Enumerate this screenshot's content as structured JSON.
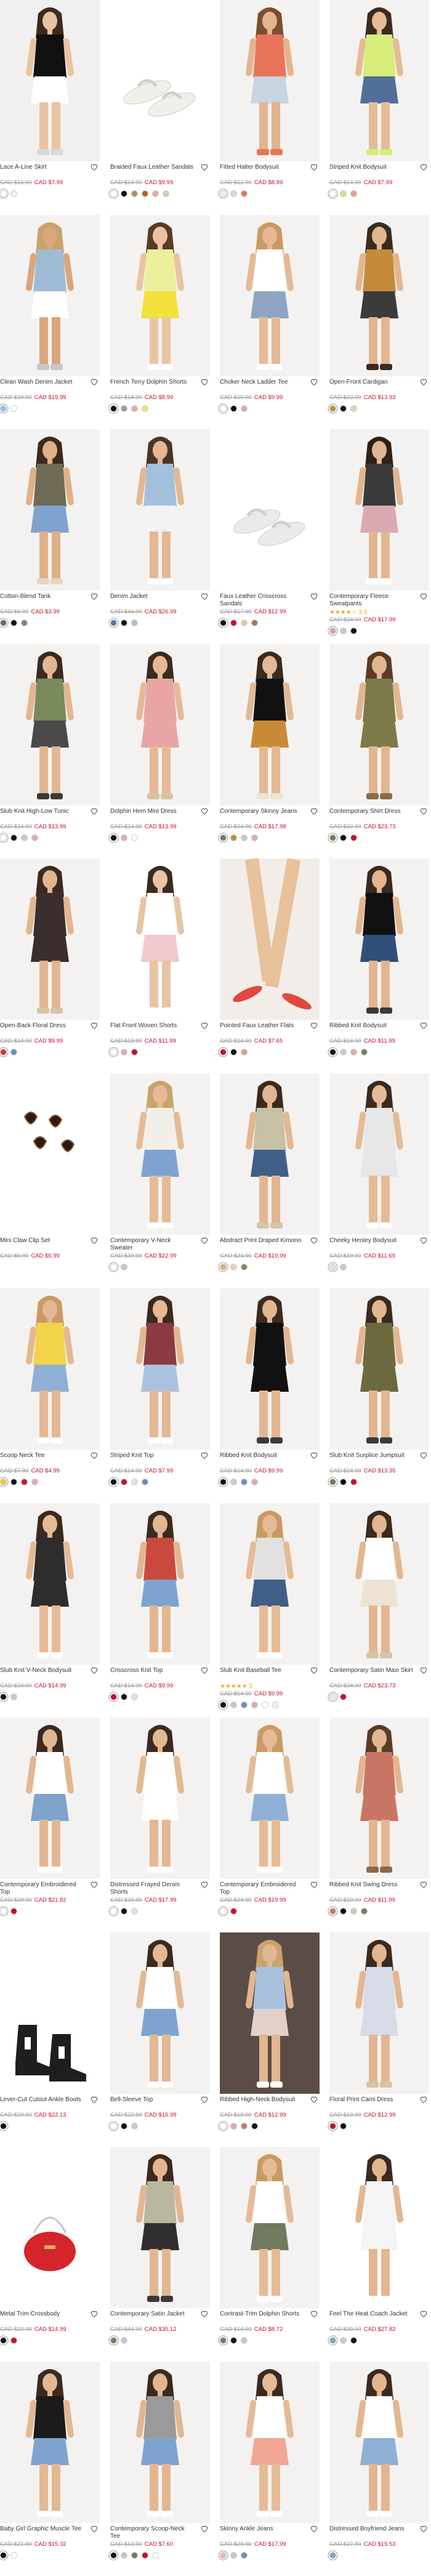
{
  "products": [
    {
      "name": "Lace A-Line Skirt",
      "old_price": "CAD $16.90",
      "price": "CAD $7.99",
      "price_type": "sale",
      "swatches": [
        "#ffffff",
        "#f2f2f2"
      ],
      "photo": {
        "bg": "#f2f0ee",
        "skin": "#e8c4a2",
        "hair": "#3b2a1f",
        "top": "#111111",
        "bottom": "#ffffff",
        "shoe": "#d9d9d9"
      }
    },
    {
      "name": "Braided Faux Leather Sandals",
      "old_price": "CAD $14.90",
      "price": "CAD $9.99",
      "price_type": "sale",
      "swatches": [
        "#ffffff",
        "#111111",
        "#b98a5e",
        "#b5651d",
        "#e3a6a8",
        "#d8c9b3"
      ],
      "photo": {
        "bg": "#ffffff",
        "item": "sandals",
        "sole": "#f1efe9",
        "strap": "#f7f7f7"
      }
    },
    {
      "name": "Fitted Halter Bodysuit",
      "old_price": "CAD $12.90",
      "price": "CAD $8.99",
      "price_type": "sale",
      "swatches": [
        "#f0f0f0",
        "#d9d9d9",
        "#e8745a"
      ],
      "photo": {
        "bg": "#f4f2f0",
        "skin": "#e2b48f",
        "hair": "#7a4e2e",
        "top": "#e8745a",
        "bottom": "#c8d4e0",
        "shoe": "#e8745a"
      }
    },
    {
      "name": "Striped Knit Bodysuit",
      "old_price": "CAD $14.90",
      "price": "CAD $7.99",
      "price_type": "sale",
      "swatches": [
        "#ffffff",
        "#cfe37a",
        "#e0a089"
      ],
      "photo": {
        "bg": "#f4f2f0",
        "skin": "#e4bb95",
        "hair": "#3a2a20",
        "top": "#d7ec79",
        "bottom": "#4f6f99",
        "shoe": "#d7ec79"
      }
    },
    {
      "name": "Clean Wash Denim Jacket",
      "old_price": "CAD $39.90",
      "price": "CAD $19.99",
      "price_type": "sale",
      "swatches": [
        "#9fbbd6",
        "#ffffff"
      ],
      "photo": {
        "bg": "#f4f2f0",
        "skin": "#d9a67e",
        "hair": "#c9a36b",
        "top": "#9fbbd6",
        "bottom": "#ffffff",
        "shoe": "#c7c7c7"
      }
    },
    {
      "name": "French Terry Dolphin Shorts",
      "old_price": "CAD $14.90",
      "price": "CAD $8.99",
      "price_type": "sale",
      "swatches": [
        "#111111",
        "#9a9a9a",
        "#e0a9b0",
        "#f2e46b"
      ],
      "photo": {
        "bg": "#f4f2f0",
        "skin": "#e8c4a2",
        "hair": "#5a3b24",
        "top": "#ecf09a",
        "bottom": "#f2e13b",
        "shoe": "#ffffff"
      }
    },
    {
      "name": "Choker Neck Ladder Tee",
      "old_price": "CAD $19.90",
      "price": "CAD $9.99",
      "price_type": "sale",
      "swatches": [
        "#ffffff",
        "#111111",
        "#e0a9b0"
      ],
      "photo": {
        "bg": "#f4f2f0",
        "skin": "#e5b996",
        "hair": "#c99a63",
        "top": "#ffffff",
        "bottom": "#8ea4c2",
        "shoe": "#ffffff"
      }
    },
    {
      "name": "Open-Front Cardigan",
      "old_price": "CAD $22.90",
      "price": "CAD $13.93",
      "price_type": "sale",
      "swatches": [
        "#c58a3a",
        "#111111",
        "#e0d2b8"
      ],
      "photo": {
        "bg": "#f4f2f0",
        "skin": "#e2b690",
        "hair": "#3b2a1f",
        "top": "#c58a3a",
        "bottom": "#3b3b3b",
        "shoe": "#3a2a20"
      }
    },
    {
      "name": "Cotton-Blend Tank",
      "old_price": "CAD $6.90",
      "price": "CAD $3.99",
      "price_type": "sale",
      "swatches": [
        "#6b6b6b",
        "#111111",
        "#8f7f6a"
      ],
      "photo": {
        "bg": "#f4f2f0",
        "skin": "#e0b088",
        "hair": "#3a2a20",
        "top": "#6f6a55",
        "bottom": "#7fa3cf",
        "shoe": "#e3d7c4"
      }
    },
    {
      "name": "Denim Jacket",
      "old_price": "CAD $44.90",
      "price": "CAD $26.99",
      "price_type": "sale",
      "swatches": [
        "#5579a8",
        "#111111",
        "#a6bed8"
      ],
      "photo": {
        "bg": "#f4f2f0",
        "skin": "#e3b892",
        "hair": "#4d3524",
        "top": "#a3c0dc",
        "bottom": "#f2f2f2",
        "shoe": "#ffffff"
      }
    },
    {
      "name": "Faux Leather Crisscross Sandals",
      "old_price": "CAD $17.90",
      "price": "CAD $12.99",
      "price_type": "sale",
      "swatches": [
        "#111111",
        "#c8102e",
        "#e3c9a6",
        "#b37046"
      ],
      "photo": {
        "bg": "#ffffff",
        "item": "sandals",
        "sole": "#eaeaea",
        "strap": "#f6f6f6"
      }
    },
    {
      "name": "Contemporary Fleece Sweatpants",
      "rating": "★★★★☆ 3.5",
      "old_price": "CAD $24.90",
      "price": "CAD $17.99",
      "price_type": "sale",
      "swatches": [
        "#cfa6a6",
        "#c8c8c8",
        "#111111"
      ],
      "photo": {
        "bg": "#f4f2f0",
        "skin": "#e2b690",
        "hair": "#2f2018",
        "top": "#3a3a3a",
        "bottom": "#d9aab2",
        "shoe": "#ffffff"
      }
    },
    {
      "name": "Slub Knit High-Low Tunic",
      "old_price": "CAD $24.90",
      "price": "CAD $13.99",
      "price_type": "sale",
      "swatches": [
        "#ffffff",
        "#111111",
        "#c8c8c8",
        "#e0a9b0"
      ],
      "photo": {
        "bg": "#f4f2f0",
        "skin": "#e2b690",
        "hair": "#3a2a20",
        "top": "#7a8a5b",
        "bottom": "#4a4a4a",
        "shoe": "#3a3a3a"
      }
    },
    {
      "name": "Dolphin Hem Mini Dress",
      "old_price": "CAD $24.90",
      "price": "CAD $13.99",
      "price_type": "sale",
      "swatches": [
        "#111111",
        "#e0a9b0",
        "#ffffff"
      ],
      "photo": {
        "bg": "#f4f2f0",
        "skin": "#e5b996",
        "hair": "#3a2a20",
        "top": "#e9a5a5",
        "bottom": "#e9a5a5",
        "shoe": "#d7c3a5"
      }
    },
    {
      "name": "Contemporary Skinny Jeans",
      "old_price": "CAD $24.90",
      "price": "CAD $17.98",
      "price_type": "sale",
      "swatches": [
        "#6d7f5e",
        "#c58a3a",
        "#c8c8c8",
        "#e0a9b0"
      ],
      "photo": {
        "bg": "#f4f2f0",
        "skin": "#e3b892",
        "hair": "#3a2a20",
        "top": "#111111",
        "bottom": "#c98a35",
        "shoe": "#ede3d0"
      }
    },
    {
      "name": "Contemporary Shirt Dress",
      "old_price": "CAD $32.90",
      "price": "CAD $23.73",
      "price_type": "sale",
      "swatches": [
        "#6d7f5e",
        "#111111",
        "#c8102e"
      ],
      "photo": {
        "bg": "#f4f2f0",
        "skin": "#e2b690",
        "hair": "#5a3b24",
        "top": "#7c7a4a",
        "bottom": "#7c7a4a",
        "shoe": "#8a6a4a"
      }
    },
    {
      "name": "Open-Back Floral Dress",
      "old_price": "CAD $14.90",
      "price": "CAD $9.99",
      "price_type": "sale",
      "swatches": [
        "#d2383b",
        "#6b8cc0"
      ],
      "photo": {
        "bg": "#f4f2f0",
        "skin": "#e2b690",
        "hair": "#3a2a20",
        "top": "#3a2e2e",
        "bottom": "#3a2e2e",
        "shoe": "#d7c3a5"
      }
    },
    {
      "name": "Flat Front Woven Shorts",
      "old_price": "CAD $19.90",
      "price": "CAD $11.99",
      "price_type": "sale",
      "swatches": [
        "#ffffff",
        "#e0a9b0",
        "#c8102e"
      ],
      "photo": {
        "bg": "#ffffff",
        "skin": "#e8c4a2",
        "hair": "#3a2a20",
        "top": "#ffffff",
        "bottom": "#f2c9cf",
        "shoe": "#ffffff"
      }
    },
    {
      "name": "Pointed Faux Leather Flats",
      "old_price": "CAD $14.90",
      "price": "CAD $7.65",
      "price_type": "sale",
      "swatches": [
        "#c8102e",
        "#111111",
        "#e3a07a"
      ],
      "photo": {
        "bg": "#f2ede8",
        "item": "flats",
        "shoe": "#e2473e",
        "skin": "#e8c09a"
      }
    },
    {
      "name": "Ribbed Knit Bodysuit",
      "old_price": "CAD $16.90",
      "price": "CAD $11.99",
      "price_type": "sale",
      "swatches": [
        "#111111",
        "#c8c8c8",
        "#e0a9b0",
        "#6d7f5e"
      ],
      "photo": {
        "bg": "#f4f2f0",
        "skin": "#e2b690",
        "hair": "#3a2a20",
        "top": "#111111",
        "bottom": "#2f4f79",
        "shoe": "#3a3a3a"
      }
    },
    {
      "name": "Mini Claw Clip Set",
      "old_price": "CAD $6.90",
      "price": "CAD $5.99",
      "price_type": "sale",
      "swatches": [],
      "photo": {
        "bg": "#ffffff",
        "item": "clips"
      }
    },
    {
      "name": "Contemporary V-Neck Sweater",
      "old_price": "CAD $39.90",
      "price": "CAD $22.99",
      "price_type": "sale",
      "swatches": [
        "#ffffff",
        "#c8c8c8"
      ],
      "photo": {
        "bg": "#f4f2f0",
        "skin": "#e5bb96",
        "hair": "#c9a36b",
        "top": "#f2efe9",
        "bottom": "#7fa3cf",
        "shoe": "#ffffff"
      }
    },
    {
      "name": "Abstract Print Draped Kimono",
      "old_price": "CAD $24.90",
      "price": "CAD $19.99",
      "price_type": "sale",
      "swatches": [
        "#d7b56d",
        "#e0d2b8",
        "#8f7f6a"
      ],
      "photo": {
        "bg": "#f4f2f0",
        "skin": "#e2b690",
        "hair": "#3a2a20",
        "top": "#c7c1a6",
        "bottom": "#3f5f88",
        "shoe": "#d7c3a5"
      }
    },
    {
      "name": "Cheeky Henley Bodysuit",
      "old_price": "CAD $19.90",
      "price": "CAD $11.69",
      "price_type": "sale",
      "swatches": [
        "#e0e0e0",
        "#c8c8c8"
      ],
      "photo": {
        "bg": "#f4f2f0",
        "skin": "#e5bb96",
        "hair": "#3a2a20",
        "top": "#e7e7e7",
        "bottom": "#e7e7e7",
        "shoe": "#ffffff"
      }
    },
    {
      "name": "Scoop Neck Tee",
      "old_price": "CAD $7.90",
      "price": "CAD $4.99",
      "price_type": "sale",
      "swatches": [
        "#e8c64e",
        "#111111",
        "#c8102e",
        "#e0a9b0"
      ],
      "photo": {
        "bg": "#f4f2f0",
        "skin": "#e3b892",
        "hair": "#c99a63",
        "top": "#f2d34a",
        "bottom": "#8fb0d6",
        "shoe": "#ffffff"
      }
    },
    {
      "name": "Striped Knit Top",
      "old_price": "CAD $14.90",
      "price": "CAD $7.99",
      "price_type": "sale",
      "swatches": [
        "#111111",
        "#c8102e",
        "#e0e0e0",
        "#6b8cc0"
      ],
      "photo": {
        "bg": "#f4f2f0",
        "skin": "#e3b892",
        "hair": "#3a2a20",
        "top": "#8a3b42",
        "bottom": "#a9c3df",
        "shoe": "#ffffff"
      }
    },
    {
      "name": "Ribbed Knit Bodysuit",
      "old_price": "CAD $14.90",
      "price": "CAD $9.99",
      "price_type": "sale",
      "swatches": [
        "#111111",
        "#c8c8c8",
        "#6b8cc0",
        "#e0a9b0"
      ],
      "photo": {
        "bg": "#f4f2f0",
        "skin": "#e2b690",
        "hair": "#3a2a20",
        "top": "#111111",
        "bottom": "#111111",
        "shoe": "#3a3a3a"
      }
    },
    {
      "name": "Slub Knit Surplice Jumpsuit",
      "old_price": "CAD $24.90",
      "price": "CAD $13.35",
      "price_type": "sale",
      "swatches": [
        "#6d7f5e",
        "#111111",
        "#c8102e"
      ],
      "photo": {
        "bg": "#f4f2f0",
        "skin": "#e2b690",
        "hair": "#3a2a20",
        "top": "#6b6a3e",
        "bottom": "#6b6a3e",
        "shoe": "#3a3a3a"
      }
    },
    {
      "name": "Slub Knit V-Neck Bodysuit",
      "old_price": "CAD $24.90",
      "price": "CAD $14.99",
      "price_type": "sale",
      "swatches": [
        "#111111",
        "#c8c8c8"
      ],
      "photo": {
        "bg": "#f4f2f0",
        "skin": "#e5bb96",
        "hair": "#3a2a20",
        "top": "#2d2d2d",
        "bottom": "#2d2d2d",
        "shoe": "#ffffff"
      }
    },
    {
      "name": "Crisscross Knit Top",
      "old_price": "CAD $14.90",
      "price": "CAD $9.99",
      "price_type": "sale",
      "swatches": [
        "#c8102e",
        "#111111",
        "#e0e0e0"
      ],
      "photo": {
        "bg": "#f4f2f0",
        "skin": "#e2b690",
        "hair": "#3a2a20",
        "top": "#c94a3c",
        "bottom": "#7fa3cf",
        "shoe": "#ffffff"
      }
    },
    {
      "name": "Slub Knit Baseball Tee",
      "rating": "★★★★★ 5",
      "old_price": "CAD $14.90",
      "price": "CAD $9.99",
      "price_type": "sale",
      "swatches": [
        "#111111",
        "#c8c8c8",
        "#6b8cc0",
        "#e0a9b0",
        "#ffffff",
        "#f2f2f2"
      ],
      "photo": {
        "bg": "#f4f2f0",
        "skin": "#e5bb96",
        "hair": "#c99a63",
        "top": "#e0e0e0",
        "bottom": "#3f5f88",
        "shoe": "#ffffff"
      }
    },
    {
      "name": "Contemporary Satin Maxi Skirt",
      "old_price": "CAD $34.90",
      "price": "CAD $23.73",
      "price_type": "sale",
      "swatches": [
        "#f0e6d6",
        "#c8102e"
      ],
      "photo": {
        "bg": "#f4f2f0",
        "skin": "#e2b690",
        "hair": "#3a2a20",
        "top": "#ffffff",
        "bottom": "#ede3d4",
        "shoe": "#d7c3a5"
      }
    },
    {
      "name": "Contemporary Embroidered Top",
      "old_price": "CAD $29.90",
      "price": "CAD $21.82",
      "price_type": "sale",
      "swatches": [
        "#ffffff",
        "#c8102e"
      ],
      "photo": {
        "bg": "#f4f2f0",
        "skin": "#e2b690",
        "hair": "#3a2a20",
        "top": "#ffffff",
        "bottom": "#7fa3cf",
        "shoe": "#ffffff"
      }
    },
    {
      "name": "Distressed Frayed Denim Shorts",
      "old_price": "CAD $24.90",
      "price": "CAD $17.99",
      "price_type": "sale",
      "swatches": [
        "#ffffff",
        "#111111",
        "#e0e0e0"
      ],
      "photo": {
        "bg": "#f4f2f0",
        "skin": "#e3b892",
        "hair": "#3a2a20",
        "top": "#ffffff",
        "bottom": "#ffffff",
        "shoe": "#ffffff"
      }
    },
    {
      "name": "Contemporary Embroidered Top",
      "old_price": "CAD $24.90",
      "price": "CAD $19.99",
      "price_type": "sale",
      "swatches": [
        "#ffffff",
        "#c8102e"
      ],
      "photo": {
        "bg": "#f4f2f0",
        "skin": "#e5bb96",
        "hair": "#c99a63",
        "top": "#ffffff",
        "bottom": "#8fb0d6",
        "shoe": "#ffffff"
      }
    },
    {
      "name": "Ribbed Knit Swing Dress",
      "old_price": "CAD $19.90",
      "price": "CAD $11.99",
      "price_type": "sale",
      "swatches": [
        "#c87565",
        "#111111",
        "#c8c8c8",
        "#6d7f5e"
      ],
      "photo": {
        "bg": "#f4f2f0",
        "skin": "#e2b690",
        "hair": "#5a3b24",
        "top": "#c87565",
        "bottom": "#c87565",
        "shoe": "#8a6a4a"
      }
    },
    {
      "name": "Lever-Cut Cutout Ankle Boots",
      "old_price": "CAD $29.90",
      "price": "CAD $22.13",
      "price_type": "sale",
      "swatches": [
        "#111111"
      ],
      "photo": {
        "bg": "#ffffff",
        "item": "boots",
        "shoe": "#1e1e1e"
      }
    },
    {
      "name": "Bell-Sleeve Top",
      "old_price": "CAD $22.90",
      "price": "CAD $15.99",
      "price_type": "sale",
      "swatches": [
        "#ffffff",
        "#111111",
        "#c8c8c8"
      ],
      "photo": {
        "bg": "#f4f2f0",
        "skin": "#e3b892",
        "hair": "#3a2a20",
        "top": "#ffffff",
        "bottom": "#7fa3cf",
        "shoe": "#ffffff"
      }
    },
    {
      "name": "Ribbed High-Neck Bodysuit",
      "old_price": "CAD $19.90",
      "price": "CAD $12.99",
      "price_type": "sale",
      "swatches": [
        "#ffffff",
        "#e0a9b0",
        "#c87565",
        "#111111"
      ],
      "photo": {
        "bg": "#5a4d47",
        "skin": "#e2b690",
        "hair": "#c9a36b",
        "top": "#a7c1dd",
        "bottom": "#e3d0c8",
        "shoe": "#ffffff"
      }
    },
    {
      "name": "Floral Print Cami Dress",
      "old_price": "CAD $19.90",
      "price": "CAD $12.99",
      "price_type": "sale",
      "swatches": [
        "#c8102e",
        "#111111"
      ],
      "photo": {
        "bg": "#f4f2f0",
        "skin": "#e2b690",
        "hair": "#3a2a20",
        "top": "#d7dbe6",
        "bottom": "#d7dbe6",
        "shoe": "#d7c3a5"
      }
    },
    {
      "name": "Metal Trim Crossbody",
      "old_price": "CAD $22.90",
      "price": "CAD $14.99",
      "price_type": "sale",
      "swatches": [
        "#111111",
        "#c8102e"
      ],
      "photo": {
        "bg": "#ffffff",
        "item": "bag",
        "shoe": "#d4252b"
      }
    },
    {
      "name": "Contemporary Satin Jacket",
      "old_price": "CAD $44.90",
      "price": "CAD $35.12",
      "price_type": "sale",
      "swatches": [
        "#6d7f5e",
        "#c8c8c8"
      ],
      "photo": {
        "bg": "#f4f2f0",
        "skin": "#e2b690",
        "hair": "#3a2a20",
        "top": "#b9b7a0",
        "bottom": "#2f2f2f",
        "shoe": "#3a3a3a"
      }
    },
    {
      "name": "Contrast-Trim Dolphin Shorts",
      "old_price": "CAD $14.90",
      "price": "CAD $8.72",
      "price_type": "sale",
      "swatches": [
        "#6d7f5e",
        "#111111",
        "#c8c8c8"
      ],
      "photo": {
        "bg": "#f4f2f0",
        "skin": "#e5bb96",
        "hair": "#c99a63",
        "top": "#ffffff",
        "bottom": "#6f7a5e",
        "shoe": "#ffffff"
      }
    },
    {
      "name": "Feel The Heat Coach Jacket",
      "old_price": "CAD $39.90",
      "price": "CAD $27.82",
      "price_type": "sale",
      "swatches": [
        "#6bb0b8",
        "#c8c8c8",
        "#111111"
      ],
      "photo": {
        "bg": "#ffffff",
        "skin": "#e2b690",
        "hair": "#3a2a20",
        "top": "#f4f4f4",
        "bottom": "#f4f4f4",
        "shoe": "#ffffff"
      }
    },
    {
      "name": "Baby Girl Graphic Muscle Tee",
      "old_price": "CAD $21.90",
      "price": "CAD $15.32",
      "price_type": "sale",
      "swatches": [
        "#111111",
        "#ffffff"
      ],
      "photo": {
        "bg": "#f4f2f0",
        "skin": "#e3b892",
        "hair": "#3a2a20",
        "top": "#1b1b1b",
        "bottom": "#7fa3cf",
        "shoe": "#ffffff"
      }
    },
    {
      "name": "Contemporary Scoop-Neck Tee",
      "old_price": "CAD $13.90",
      "price": "CAD $7.60",
      "price_type": "sale",
      "swatches": [
        "#111111",
        "#c8c8c8",
        "#6d7f5e",
        "#c8102e",
        "#ffffff"
      ],
      "photo": {
        "bg": "#f4f2f0",
        "skin": "#e2b690",
        "hair": "#3a2a20",
        "top": "#9a9a9a",
        "bottom": "#7fa3cf",
        "shoe": "#ffffff"
      }
    },
    {
      "name": "Skinny Ankle Jeans",
      "old_price": "CAD $29.90",
      "price": "CAD $17.99",
      "price_type": "sale",
      "swatches": [
        "#f2b7a8",
        "#c8c8c8",
        "#6b8cc0"
      ],
      "photo": {
        "bg": "#f4f2f0",
        "skin": "#e5bb96",
        "hair": "#3a2a20",
        "top": "#ffffff",
        "bottom": "#f2a694",
        "shoe": "#ffffff"
      }
    },
    {
      "name": "Distressed Boyfriend Jeans",
      "old_price": "CAD $27.90",
      "price": "CAD $19.53",
      "price_type": "sale",
      "swatches": [
        "#7fa3cf"
      ],
      "photo": {
        "bg": "#f4f2f0",
        "skin": "#e2b690",
        "hair": "#3a2a20",
        "top": "#ffffff",
        "bottom": "#8fb0d6",
        "shoe": "#ffffff"
      }
    }
  ]
}
